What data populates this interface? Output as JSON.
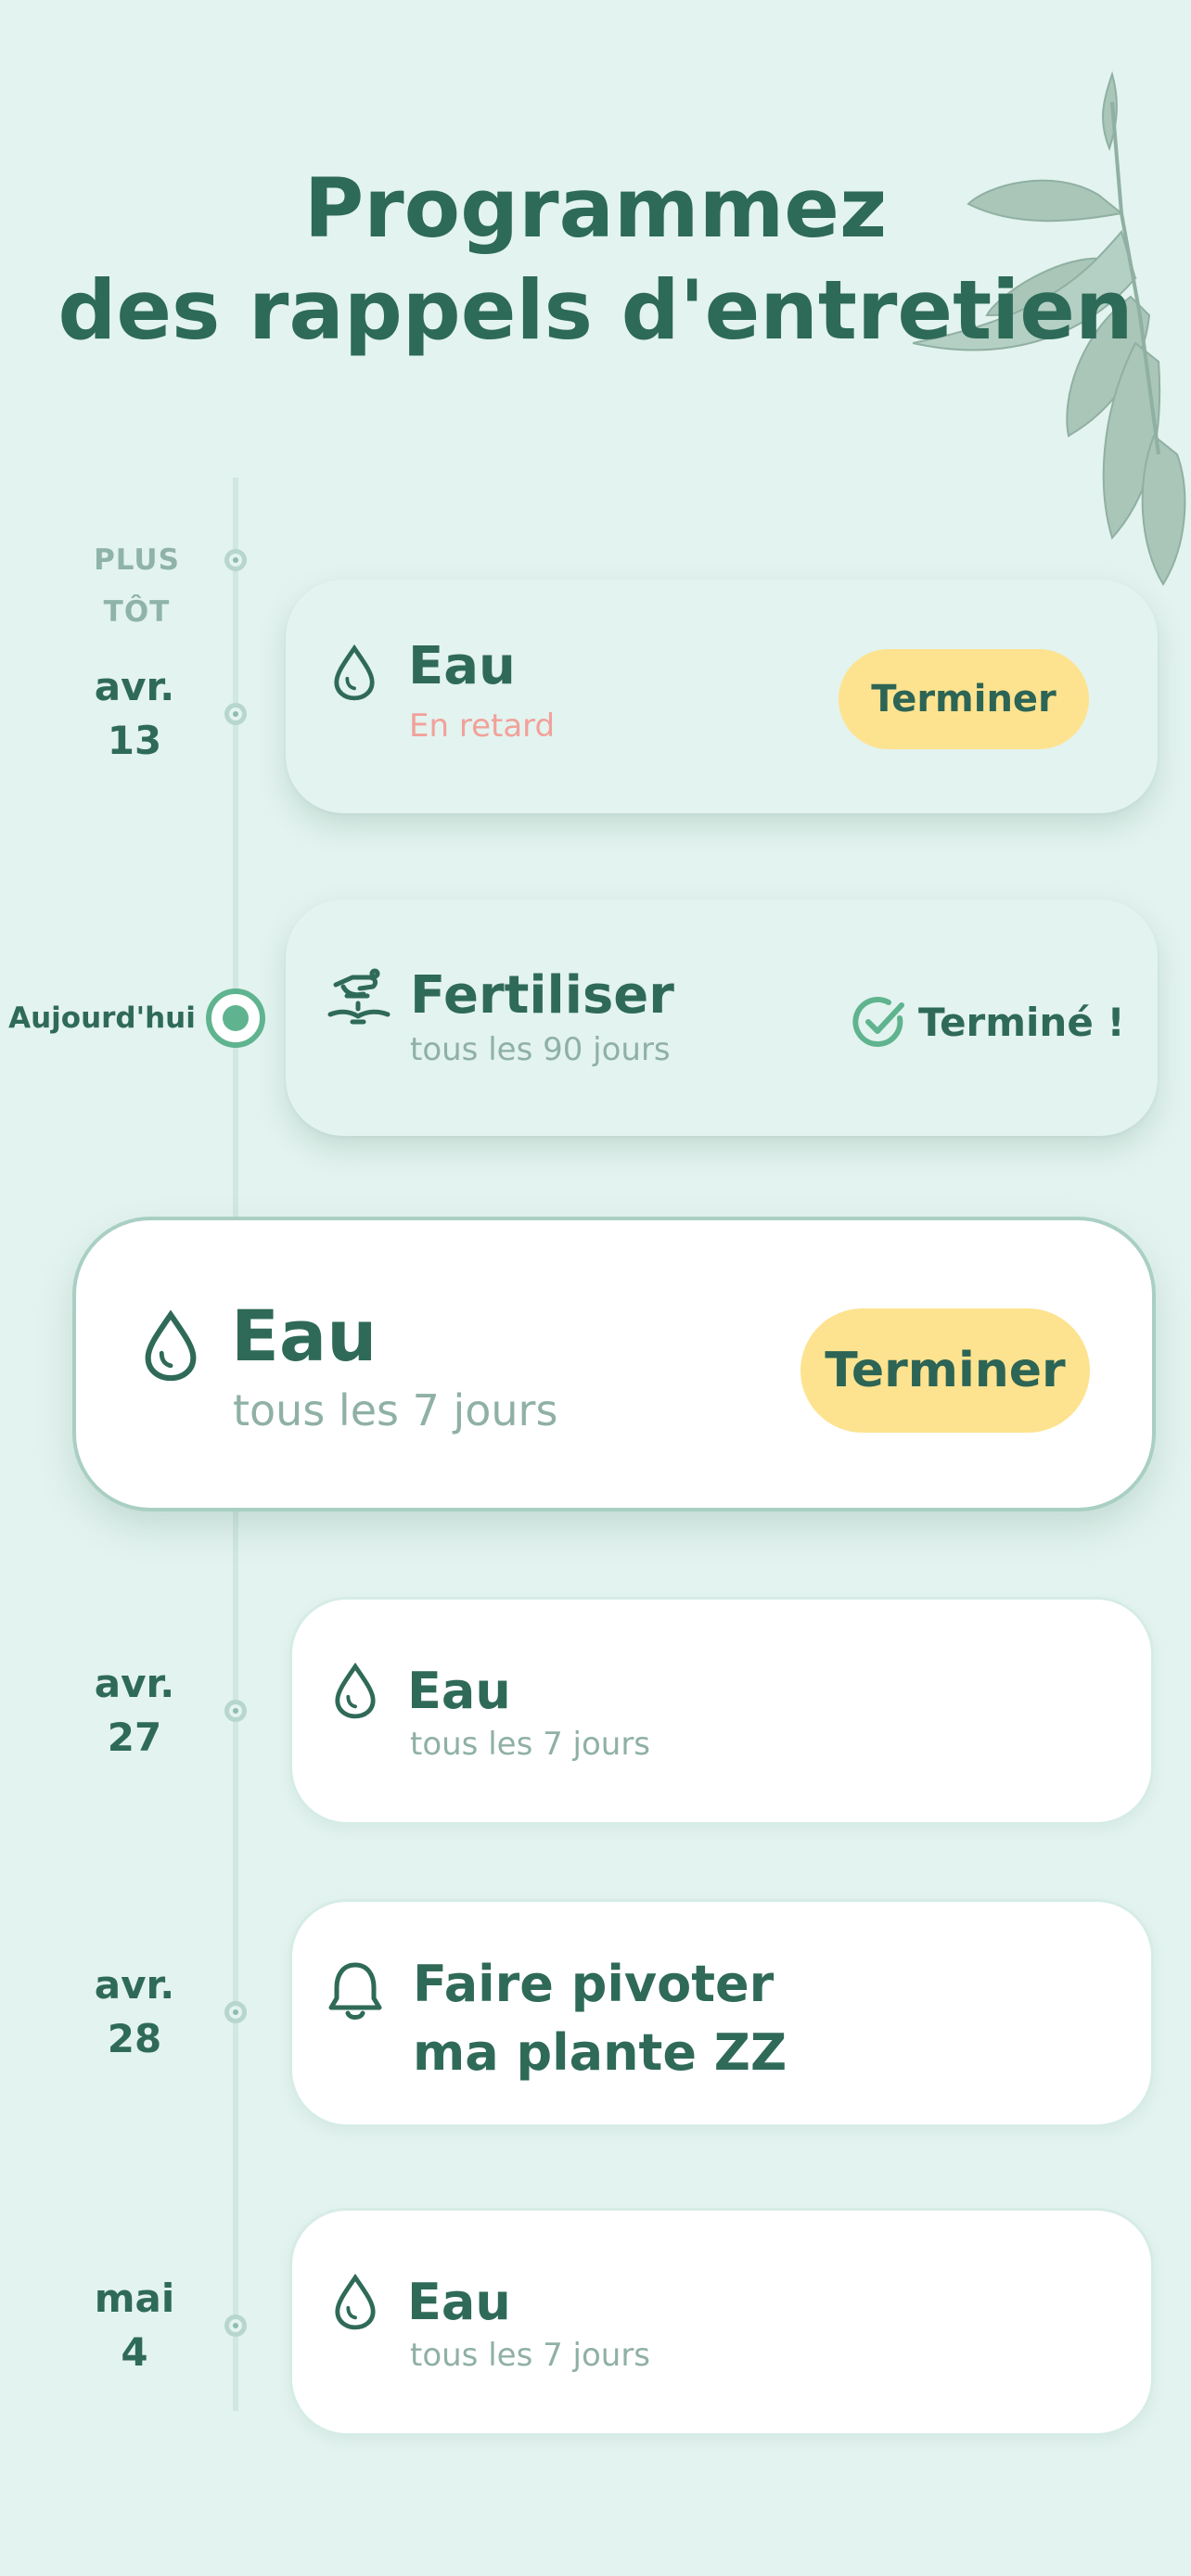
{
  "header": {
    "line1": "Programmez",
    "line2": "des rappels d'entretien"
  },
  "timeline": {
    "earlier_label": "PLUS TÔT",
    "today_label": "Aujourd'hui"
  },
  "dates": {
    "d1": {
      "month": "avr.",
      "day": "13"
    },
    "d4": {
      "month": "avr.",
      "day": "27"
    },
    "d5": {
      "month": "avr.",
      "day": "28"
    },
    "d6": {
      "month": "mai",
      "day": "4"
    }
  },
  "tasks": [
    {
      "title": "Eau",
      "subtitle": "En retard",
      "icon": "water-drop-icon",
      "action": "Terminer"
    },
    {
      "title": "Fertiliser",
      "subtitle": "tous les 90 jours",
      "icon": "fertilizer-hand-icon",
      "status": "Terminé !"
    },
    {
      "title": "Eau",
      "subtitle": "tous les 7 jours",
      "icon": "water-drop-icon",
      "action": "Terminer"
    },
    {
      "title": "Eau",
      "subtitle": "tous les 7 jours",
      "icon": "water-drop-icon"
    },
    {
      "title_line1": "Faire pivoter",
      "title_line2": "ma plante ZZ",
      "icon": "bell-icon"
    },
    {
      "title": "Eau",
      "subtitle": "tous les 7 jours",
      "icon": "water-drop-icon"
    }
  ],
  "colors": {
    "background": "#e3f3ef",
    "primary_text": "#2f6a58",
    "button": "#fde38f",
    "late": "#f2a19a",
    "done_check": "#5fb48f"
  }
}
